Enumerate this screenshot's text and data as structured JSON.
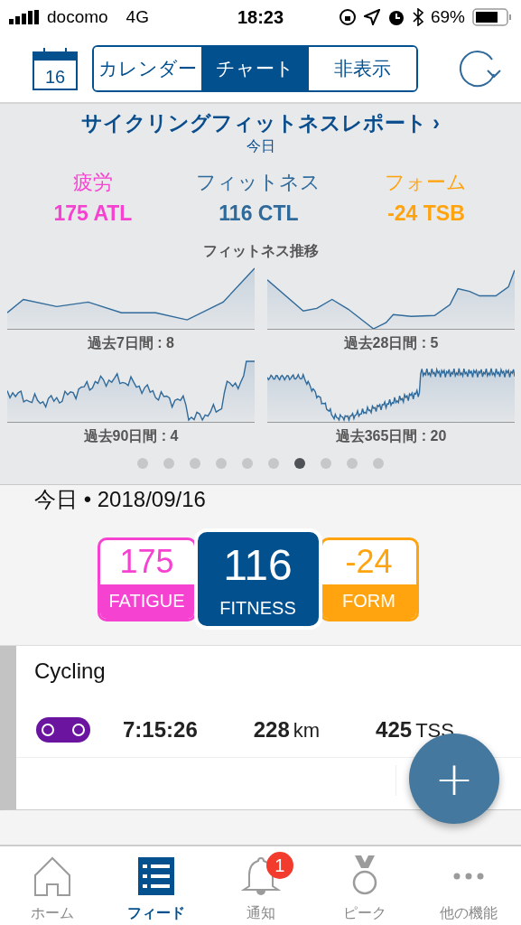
{
  "status_bar": {
    "carrier": "docomo",
    "network": "4G",
    "time": "18:23",
    "battery": "69%"
  },
  "header": {
    "calendar_day": "16",
    "segments": [
      {
        "label": "カレンダー",
        "selected": false
      },
      {
        "label": "チャート",
        "selected": true
      },
      {
        "label": "非表示",
        "selected": false
      }
    ]
  },
  "report": {
    "title": "サイクリングフィットネスレポート",
    "chevron": "›",
    "subtitle": "今日",
    "metrics": [
      {
        "label": "疲労",
        "value": "175 ATL",
        "color": "#f542d0"
      },
      {
        "label": "フィットネス",
        "value": "116 CTL",
        "color": "#2f6a9a"
      },
      {
        "label": "フォーム",
        "value": "-24 TSB",
        "color": "#ffa30f"
      }
    ],
    "trend_title": "フィットネス推移",
    "trends": [
      {
        "label": "過去7日間 : 8"
      },
      {
        "label": "過去28日間 : 5"
      },
      {
        "label": "過去90日間 : 4"
      },
      {
        "label": "過去365日間 : 20"
      }
    ],
    "page_dots": [
      {
        "selected": false
      },
      {
        "selected": false
      },
      {
        "selected": false
      },
      {
        "selected": false
      },
      {
        "selected": false
      },
      {
        "selected": false
      },
      {
        "selected": true
      },
      {
        "selected": false
      },
      {
        "selected": false
      },
      {
        "selected": false
      }
    ]
  },
  "day": {
    "date": "今日 • 2018/09/16",
    "badges": [
      {
        "value": "175",
        "label": "FATIGUE",
        "color": "#f542d0",
        "selected": false
      },
      {
        "value": "116",
        "label": "FITNESS",
        "color": "#03508f",
        "selected": true
      },
      {
        "value": "-24",
        "label": "FORM",
        "color": "#ffa30f",
        "selected": false
      }
    ]
  },
  "activity": {
    "title": "Cycling",
    "duration": "7:15:26",
    "distance": "228",
    "distance_unit": "km",
    "tss": "425",
    "tss_unit": "TSS"
  },
  "fab": {
    "symbol": "+"
  },
  "tab_bar": [
    {
      "label": "ホーム",
      "kind": "home",
      "selected": false
    },
    {
      "label": "フィード",
      "kind": "feed",
      "selected": true
    },
    {
      "label": "通知",
      "kind": "bell",
      "selected": false,
      "badge": "1"
    },
    {
      "label": "ピーク",
      "kind": "medal",
      "selected": false
    },
    {
      "label": "他の機能",
      "kind": "more",
      "selected": false
    }
  ]
}
